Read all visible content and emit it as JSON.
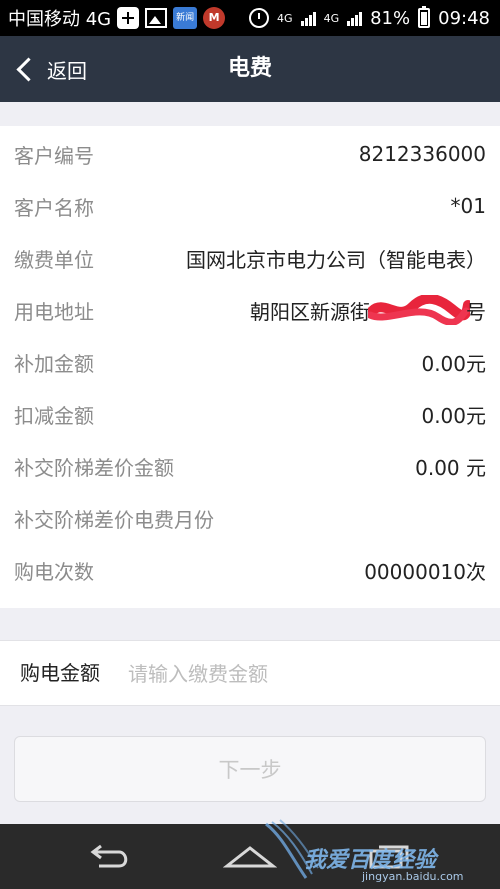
{
  "status_bar": {
    "carrier": "中国移动 4G",
    "news_label": "新闻",
    "net_type": "4G",
    "net_sub": "4G",
    "battery_text": "81%",
    "time": "09:48"
  },
  "header": {
    "back_label": "返回",
    "title": "电费"
  },
  "info_rows": [
    {
      "label": "客户编号",
      "value": "8212336000"
    },
    {
      "label": "客户名称",
      "value": "*01"
    },
    {
      "label": "缴费单位",
      "value": "国网北京市电力公司（智能电表）"
    },
    {
      "label": "用电地址",
      "value": "朝阳区新源街",
      "value_suffix": "号"
    },
    {
      "label": "补加金额",
      "value": "0.00元"
    },
    {
      "label": "扣减金额",
      "value": "0.00元"
    },
    {
      "label": "补交阶梯差价金额",
      "value": "0.00 元"
    },
    {
      "label": "补交阶梯差价电费月份",
      "value": ""
    },
    {
      "label": "购电次数",
      "value": "00000010次"
    }
  ],
  "amount": {
    "label": "购电金额",
    "placeholder": "请输入缴费金额",
    "value": ""
  },
  "next_button": {
    "label": "下一步"
  },
  "watermark": {
    "text": "我爱百度经验",
    "url": "jingyan.baidu.com"
  },
  "colors": {
    "header_bg": "#2d3644",
    "page_bg": "#efeff4",
    "label_gray": "#8c8c8c",
    "redaction_red": "#e8253c"
  }
}
